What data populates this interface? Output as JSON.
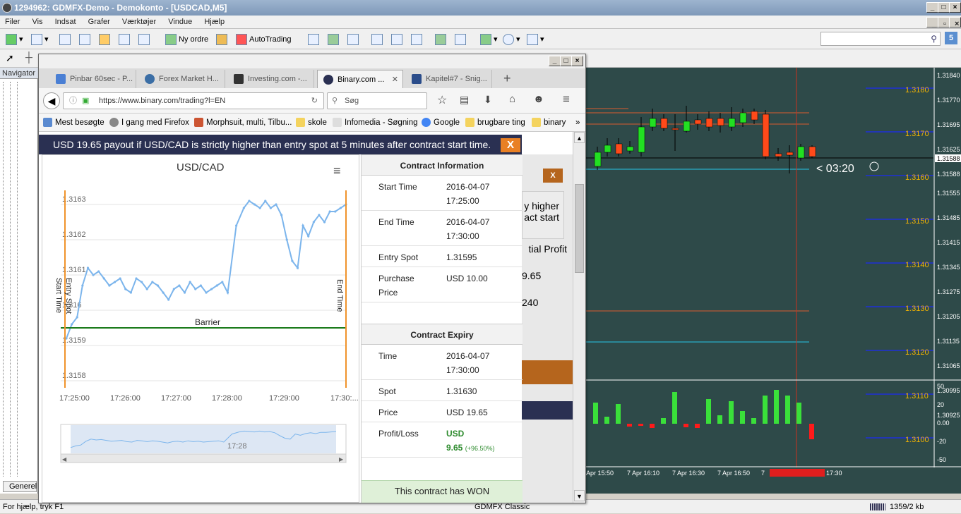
{
  "window": {
    "title": "1294962: GDMFX-Demo - Demokonto - [USDCAD,M5]"
  },
  "menu": [
    "Filer",
    "Vis",
    "Indsat",
    "Grafer",
    "Værktøjer",
    "Vindue",
    "Hjælp"
  ],
  "toolbar": {
    "new_order": "Ny ordre",
    "autotrading": "AutoTrading"
  },
  "navigator": {
    "title": "Navigator",
    "bottom_tab": "Generel"
  },
  "status": {
    "help": "For hjælp, tryk F1",
    "profile": "GDMFX Classic",
    "traffic": "1359/2 kb"
  },
  "browser": {
    "tabs": [
      {
        "label": "Pinbar 60sec - P...",
        "color": "#4a7fd4"
      },
      {
        "label": "Forex Market H...",
        "color": "#3b6ea5"
      },
      {
        "label": "Investing.com -...",
        "color": "#333"
      },
      {
        "label": "Binary.com ...",
        "color": "#2a3052"
      },
      {
        "label": "Kapitel#7 - Snig...",
        "color": "#2a4c8a"
      }
    ],
    "url": "https://www.binary.com/trading?l=EN",
    "search_placeholder": "Søg",
    "bookmarks": [
      "Mest besøgte",
      "I gang med Firefox",
      "Morphsuit, multi, Tilbu...",
      "skole",
      "Infomedia - Søgning",
      "Google",
      "brugbare ting",
      "binary"
    ]
  },
  "contract": {
    "banner": "USD 19.65 payout if USD/CAD is strictly higher than entry spot at 5 minutes after contract start time.",
    "close": "X",
    "chart_title": "USD/CAD",
    "info_header": "Contract Information",
    "start_time_label": "Start Time",
    "start_time_date": "2016-04-07",
    "start_time_time": "17:25:00",
    "end_time_label": "End Time",
    "end_time_date": "2016-04-07",
    "end_time_time": "17:30:00",
    "entry_spot_label": "Entry Spot",
    "entry_spot": "1.31595",
    "purchase_label_1": "Purchase",
    "purchase_label_2": "Price",
    "purchase_price": "USD 10.00",
    "expiry_header": "Contract Expiry",
    "time_label": "Time",
    "time_date": "2016-04-07",
    "time_time": "17:30:00",
    "spot_label": "Spot",
    "spot": "1.31630",
    "price_label": "Price",
    "price": "USD 19.65",
    "pl_label": "Profit/Loss",
    "pl_currency": "USD",
    "pl_value": "9.65",
    "pl_pct": "(+96.50%)",
    "result": "This contract has WON",
    "bg_text_1": "y higher",
    "bg_text_2": "act start",
    "bg_text_3": "tial Profit",
    "bg_text_4": "9.65",
    "bg_text_5": "240"
  },
  "chart_data": {
    "type": "line",
    "title": "USD/CAD",
    "y_ticks": [
      "1.3163",
      "1.3162",
      "1.3161",
      "1.316",
      "1.3159",
      "1.3158"
    ],
    "x_ticks": [
      "17:25:00",
      "17:26:00",
      "17:27:00",
      "17:28:00",
      "17:29:00",
      "17:30:..."
    ],
    "nav_tick": "17:28",
    "ylim": [
      1.3158,
      1.3163
    ],
    "barrier": 1.31595,
    "barrier_label": "Barrier",
    "markers": [
      "Start Time",
      "Entry Spot",
      "End Time"
    ],
    "series": [
      {
        "values": [
          1.31592,
          1.31596,
          1.31598,
          1.31607,
          1.31612,
          1.3161,
          1.31611,
          1.31609,
          1.31607,
          1.31608,
          1.31609,
          1.31606,
          1.31605,
          1.31609,
          1.31608,
          1.31606,
          1.31608,
          1.31607,
          1.31605,
          1.31603,
          1.31606,
          1.31607,
          1.31605,
          1.31608,
          1.31606,
          1.31607,
          1.31605,
          1.31606,
          1.31607,
          1.31608,
          1.31605,
          1.31624,
          1.31629,
          1.31631,
          1.3163,
          1.31629,
          1.31631,
          1.31629,
          1.3163,
          1.31627,
          1.3162,
          1.31614,
          1.31612,
          1.31624,
          1.31621,
          1.31625,
          1.31627,
          1.31625,
          1.31628,
          1.31628,
          1.31629,
          1.3163
        ]
      },
      {
        "x": [
          0,
          5,
          10,
          15,
          20,
          25,
          30,
          35,
          40,
          45,
          50,
          55,
          60,
          65,
          70,
          75,
          80,
          85,
          90,
          95,
          100,
          105,
          110,
          115,
          120,
          125,
          130,
          135,
          140,
          145,
          150,
          158,
          165,
          170,
          175,
          180,
          185,
          190,
          195,
          200,
          205,
          210,
          215,
          220,
          225,
          230,
          235,
          240,
          245,
          250,
          255,
          260
        ]
      }
    ]
  },
  "mt4": {
    "price_axis": [
      "1.31840",
      "1.31770",
      "1.31695",
      "1.31625",
      "1.31588",
      "1.31555",
      "1.31485",
      "1.31415",
      "1.31345",
      "1.31275",
      "1.31205",
      "1.31135",
      "1.31065",
      "1.30995",
      "1.30925"
    ],
    "levels": [
      "1.3180",
      "1.3170",
      "1.3160",
      "1.3150",
      "1.3140",
      "1.3130",
      "1.3120",
      "1.3110",
      "1.3100"
    ],
    "timer": "< 03:20",
    "time_axis": [
      "Apr 15:50",
      "7 Apr 16:10",
      "7 Apr 16:30",
      "7 Apr 16:50",
      "7",
      "17:30"
    ],
    "osc_axis": [
      "50",
      "20",
      "0.00",
      "-20",
      "-50"
    ]
  }
}
